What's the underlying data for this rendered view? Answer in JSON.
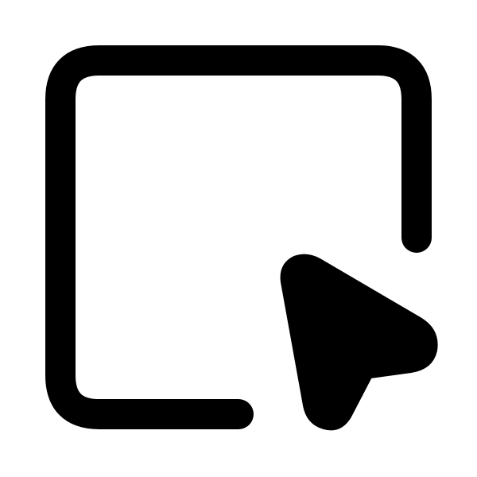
{
  "icon": {
    "name": "select-area-cursor-icon",
    "parts": [
      "square-outline-icon",
      "pointer-arrow-icon"
    ],
    "stroke_color": "#000000",
    "fill_color": "#000000",
    "background_color": "#ffffff"
  }
}
